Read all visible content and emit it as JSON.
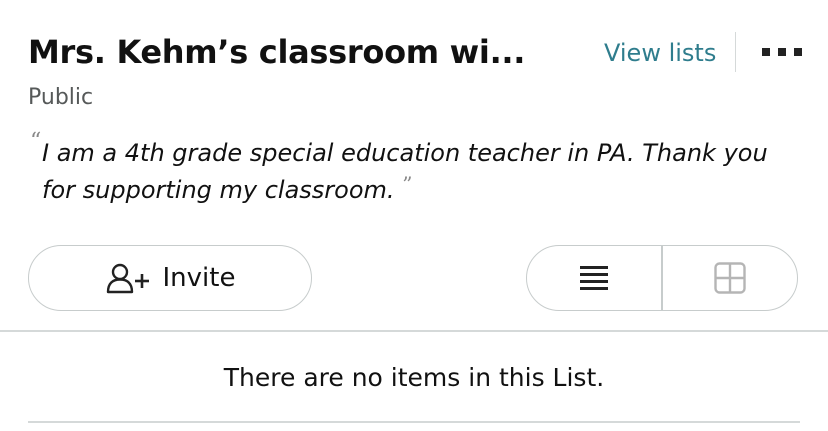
{
  "list": {
    "title": "Mrs. Kehm’s classroom wi...",
    "privacy": "Public",
    "description_open_quote": "“",
    "description": "I am a 4th grade special education teacher in PA. Thank you for supporting my classroom.",
    "description_close_quote": "”"
  },
  "header": {
    "view_lists_label": "View lists",
    "more_icon": "more-dots-icon"
  },
  "actions": {
    "invite_label": "Invite",
    "invite_icon": "add-person-icon"
  },
  "view_toggle": {
    "options": [
      {
        "icon": "list-view-icon",
        "selected": true
      },
      {
        "icon": "grid-view-icon",
        "selected": false
      }
    ]
  },
  "content": {
    "empty_message": "There are no items in this List."
  },
  "colors": {
    "link": "#2f7d8d",
    "border": "#c7cccc",
    "secondary_text": "#565959",
    "inactive_icon": "#b5b5b5"
  }
}
